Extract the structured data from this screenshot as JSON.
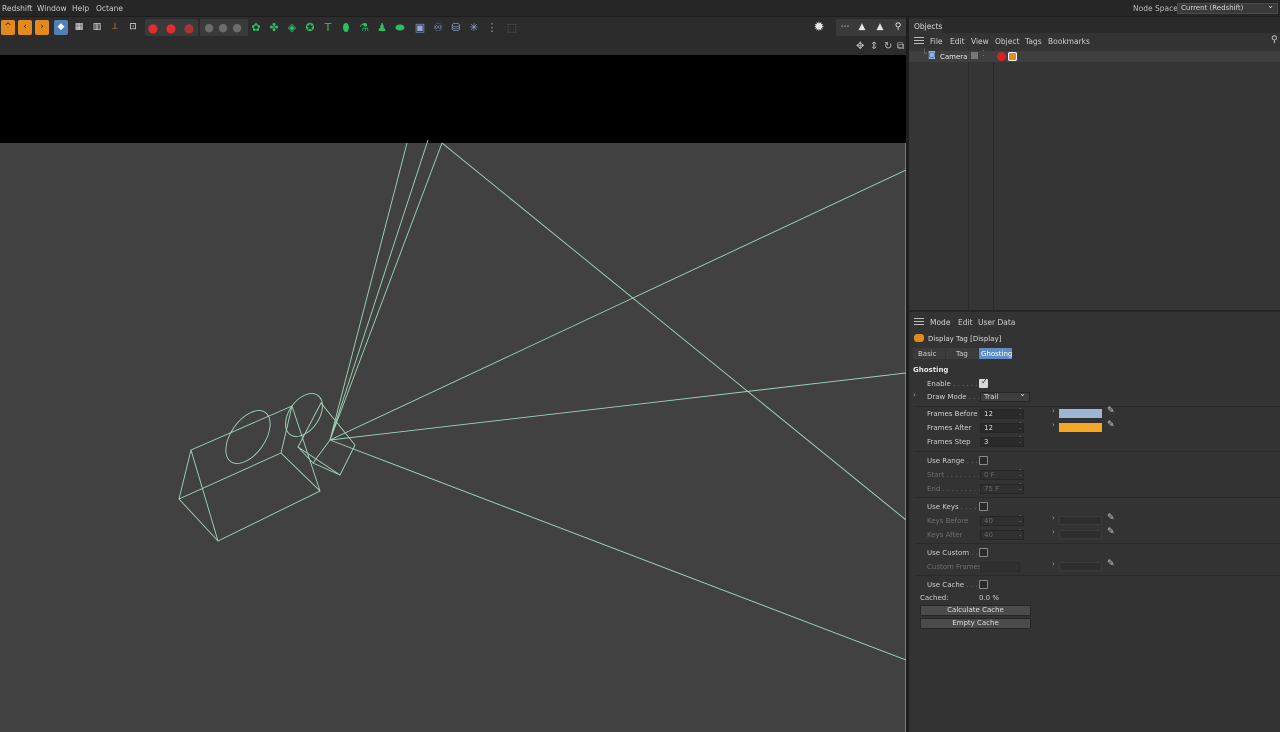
{
  "menubar": {
    "items": [
      "Redshift",
      "Window",
      "Help",
      "Octane"
    ],
    "node_space_label": "Node Space:",
    "node_space_value": "Current (Redshift)"
  },
  "objects_panel": {
    "tab_label": "Objects",
    "menu": [
      "File",
      "Edit",
      "View",
      "Object",
      "Tags",
      "Bookmarks"
    ],
    "items": [
      {
        "name": "Camera"
      }
    ]
  },
  "attributes_panel": {
    "menu": [
      "Mode",
      "Edit",
      "User Data"
    ],
    "title": "Display Tag [Display]",
    "tabs": [
      "Basic",
      "Tag",
      "Ghosting"
    ],
    "active_tab": "Ghosting",
    "section": "Ghosting",
    "enable_label": "Enable",
    "enable_checked": true,
    "draw_mode_label": "Draw Mode",
    "draw_mode_value": "Trail",
    "frames_before_label": "Frames Before",
    "frames_before_value": "12",
    "frames_before_color": "#9ab6d4",
    "frames_after_label": "Frames After",
    "frames_after_value": "12",
    "frames_after_color": "#f5a623",
    "frames_step_label": "Frames Step",
    "frames_step_value": "3",
    "use_range_label": "Use Range",
    "use_range_checked": false,
    "start_label": "Start",
    "start_value": "0 F",
    "end_label": "End",
    "end_value": "75 F",
    "use_keys_label": "Use Keys",
    "use_keys_checked": false,
    "keys_before_label": "Keys Before",
    "keys_before_value": "40",
    "keys_after_label": "Keys After",
    "keys_after_value": "40",
    "use_custom_label": "Use Custom",
    "use_custom_checked": false,
    "custom_frames_label": "Custom Frames",
    "use_cache_label": "Use Cache",
    "use_cache_checked": false,
    "cached_label": "Cached:",
    "cached_value": "0.0 %",
    "calculate_cache_label": "Calculate Cache",
    "empty_cache_label": "Empty Cache"
  },
  "colors": {
    "wireframe": "#9ed6b8",
    "accent": "#5d8dc8",
    "toolbar_orange": "#e38a1e"
  }
}
